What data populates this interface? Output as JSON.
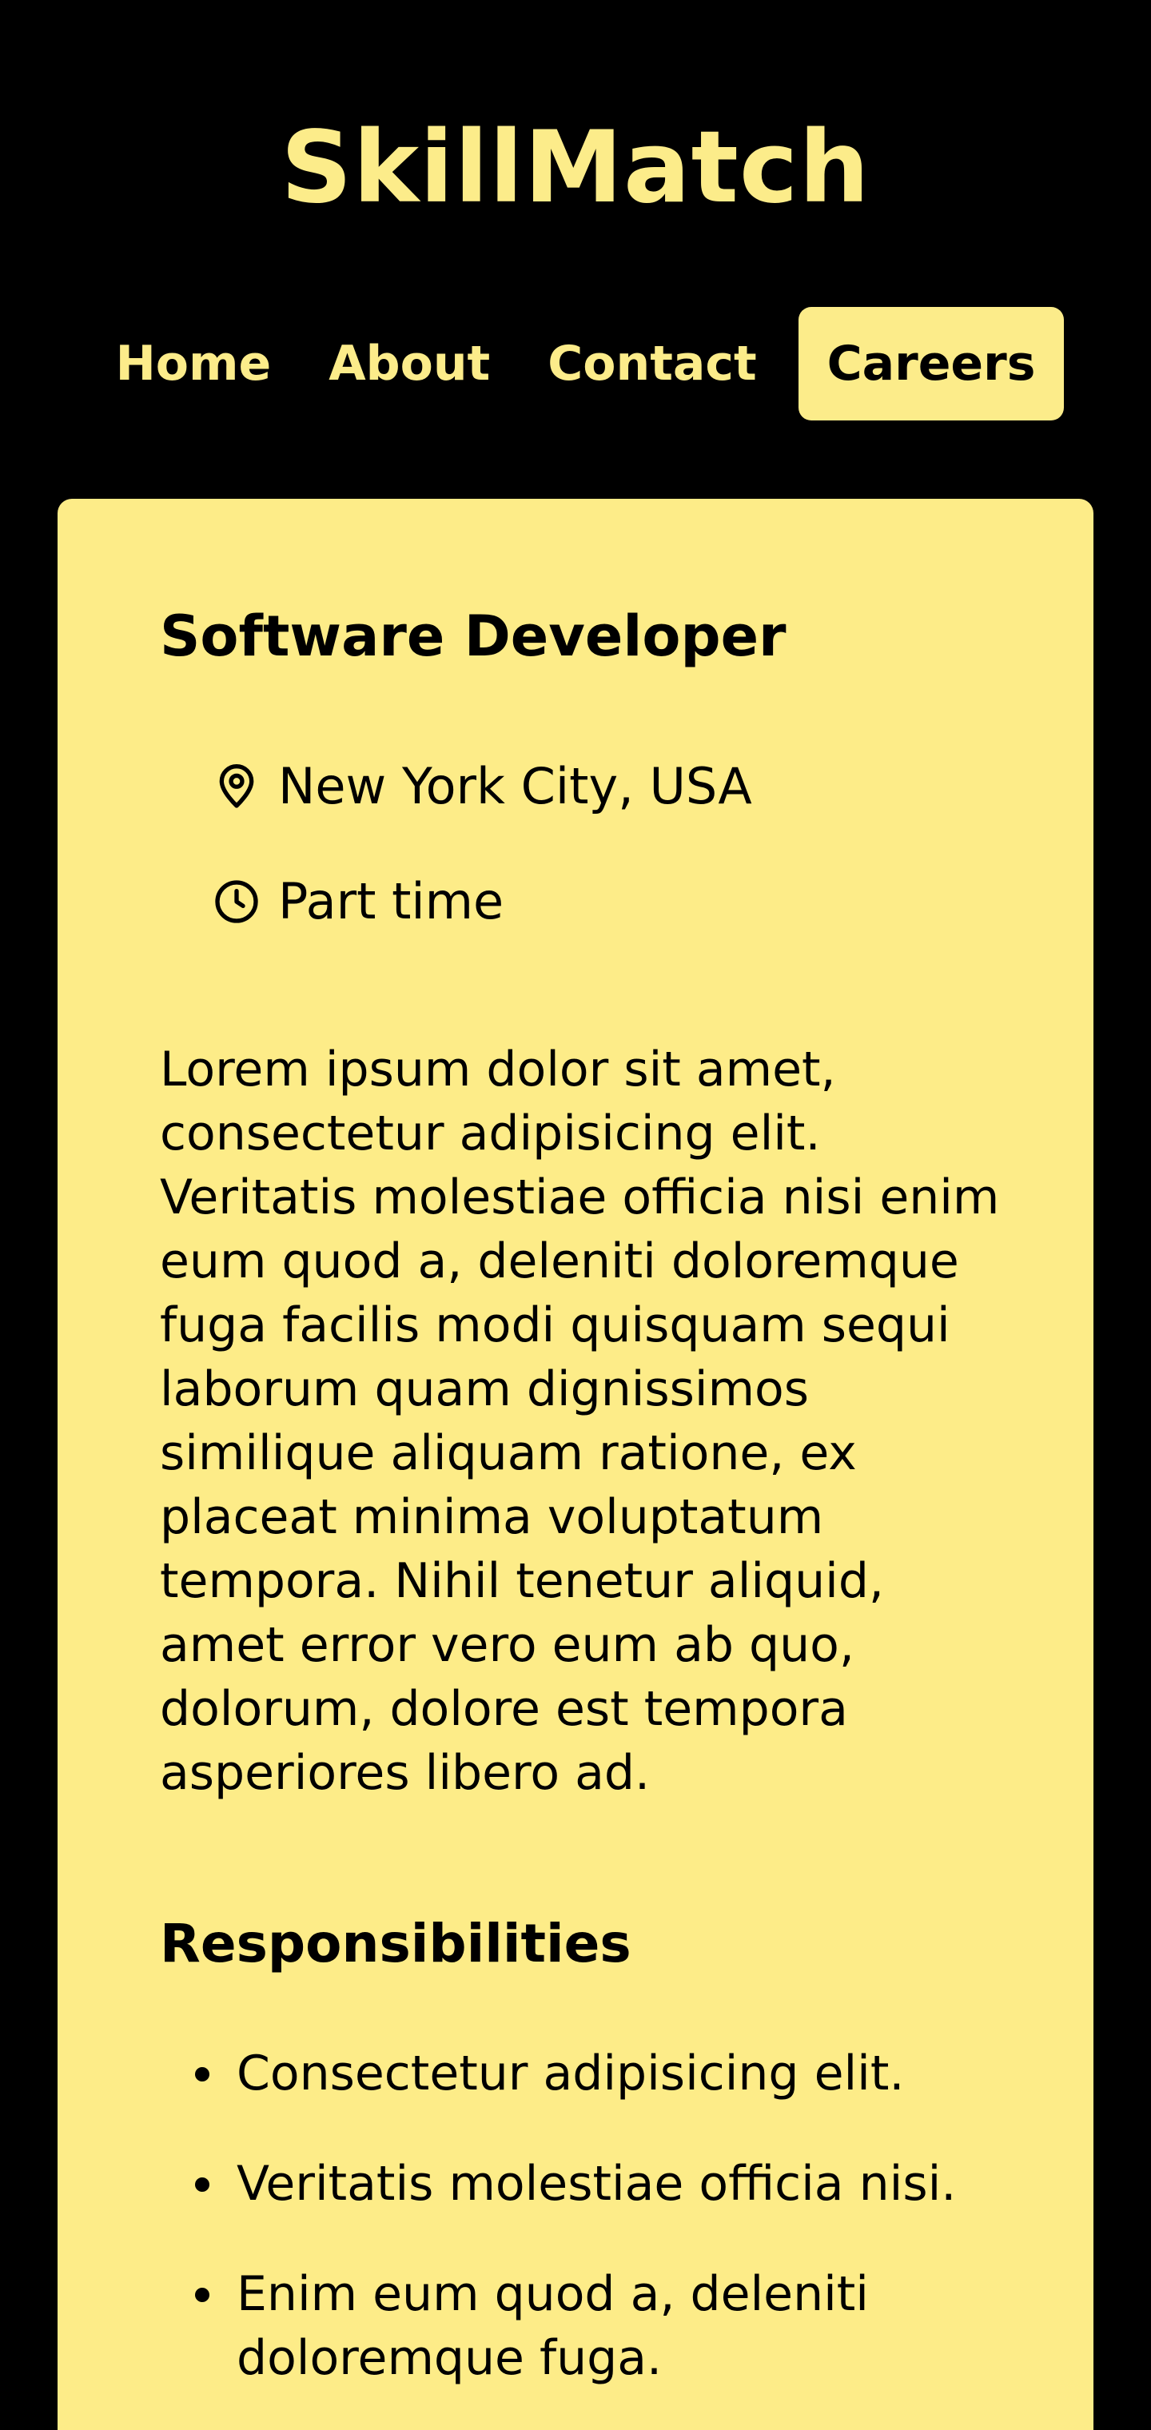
{
  "brand": {
    "name": "SkillMatch"
  },
  "nav": {
    "items": [
      {
        "label": "Home",
        "active": false
      },
      {
        "label": "About",
        "active": false
      },
      {
        "label": "Contact",
        "active": false
      },
      {
        "label": "Careers",
        "active": true
      }
    ]
  },
  "job": {
    "title": "Software Developer",
    "location": "New York City, USA",
    "type": "Part time",
    "description": "Lorem ipsum dolor sit amet, consectetur adipisicing elit. Veritatis molestiae officia nisi enim eum quod a, deleniti doloremque fuga facilis modi quisquam sequi laborum quam dignissimos similique aliquam ratione, ex placeat minima voluptatum tempora. Nihil tenetur aliquid, amet error vero eum ab quo, dolorum, dolore est tempora asperiores libero ad.",
    "responsibilities_title": "Responsibilities",
    "responsibilities": [
      "Consectetur adipisicing elit.",
      "Veritatis molestiae officia nisi.",
      "Enim eum quod a, deleniti doloremque fuga."
    ]
  },
  "icons": {
    "location": "map-pin-icon",
    "type": "clock-icon"
  },
  "colors": {
    "background": "#000000",
    "accent": "#fcec8a",
    "card": "#fdec88",
    "text": "#000000"
  }
}
